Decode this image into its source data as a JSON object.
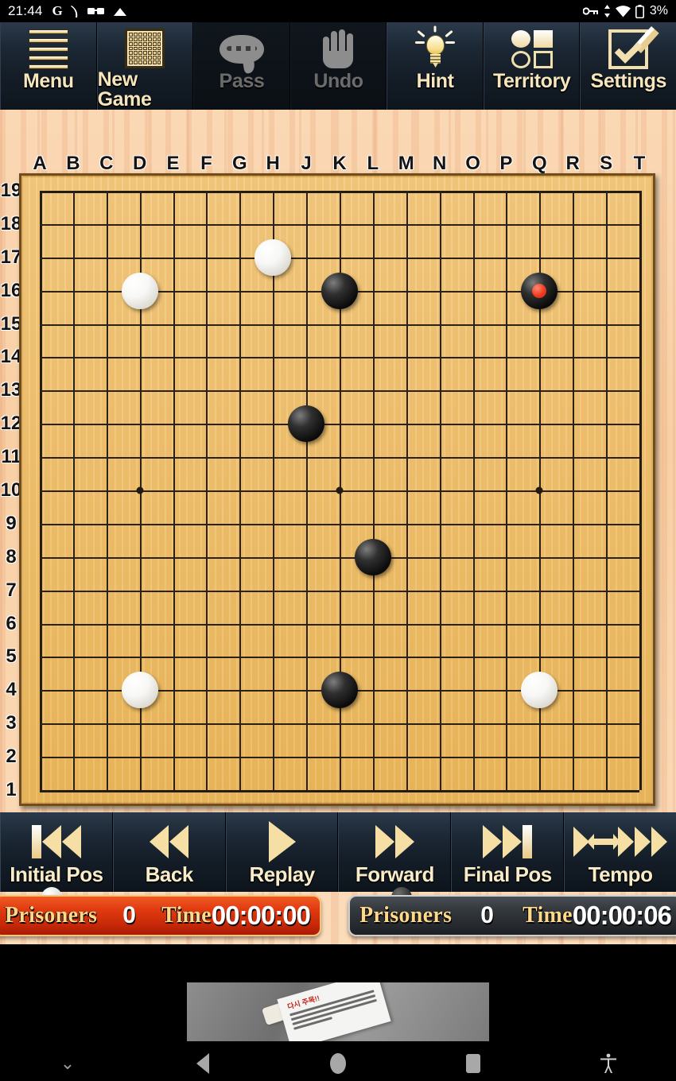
{
  "status_bar": {
    "clock": "21:44",
    "left_icons": [
      "google-g-icon",
      "signal-icon",
      "glasses-icon",
      "cloud-icon"
    ],
    "right_icons": [
      "vpn-key-icon",
      "data-transfer-icon",
      "wifi-icon",
      "battery-icon"
    ],
    "battery_percent": "3%"
  },
  "toolbar": {
    "buttons": [
      {
        "label": "Menu",
        "icon": "hamburger-menu-icon",
        "enabled": true
      },
      {
        "label": "New Game",
        "icon": "go-board-grid-icon",
        "enabled": true
      },
      {
        "label": "Pass",
        "icon": "speech-bubble-icon",
        "enabled": false
      },
      {
        "label": "Undo",
        "icon": "hand-stop-icon",
        "enabled": false
      },
      {
        "label": "Hint",
        "icon": "lightbulb-icon",
        "enabled": true
      },
      {
        "label": "Territory",
        "icon": "territory-shapes-icon",
        "enabled": true
      },
      {
        "label": "Settings",
        "icon": "checkbox-pencil-icon",
        "enabled": true
      }
    ]
  },
  "board": {
    "size": 19,
    "column_labels": [
      "A",
      "B",
      "C",
      "D",
      "E",
      "F",
      "G",
      "H",
      "J",
      "K",
      "L",
      "M",
      "N",
      "O",
      "P",
      "Q",
      "R",
      "S",
      "T"
    ],
    "row_labels": [
      "19",
      "18",
      "17",
      "16",
      "15",
      "14",
      "13",
      "12",
      "11",
      "10",
      "9",
      "8",
      "7",
      "6",
      "5",
      "4",
      "3",
      "2",
      "1"
    ],
    "star_points": [
      {
        "col": "D",
        "row": 16
      },
      {
        "col": "K",
        "row": 16
      },
      {
        "col": "Q",
        "row": 16
      },
      {
        "col": "D",
        "row": 10
      },
      {
        "col": "K",
        "row": 10
      },
      {
        "col": "Q",
        "row": 10
      },
      {
        "col": "D",
        "row": 4
      },
      {
        "col": "K",
        "row": 4
      },
      {
        "col": "Q",
        "row": 4
      }
    ],
    "stones": [
      {
        "col": "D",
        "row": 16,
        "color": "white",
        "last": false
      },
      {
        "col": "H",
        "row": 17,
        "color": "white",
        "last": false
      },
      {
        "col": "K",
        "row": 16,
        "color": "black",
        "last": false
      },
      {
        "col": "Q",
        "row": 16,
        "color": "black",
        "last": true
      },
      {
        "col": "J",
        "row": 12,
        "color": "black",
        "last": false
      },
      {
        "col": "L",
        "row": 8,
        "color": "black",
        "last": false
      },
      {
        "col": "D",
        "row": 4,
        "color": "white",
        "last": false
      },
      {
        "col": "K",
        "row": 4,
        "color": "black",
        "last": false
      },
      {
        "col": "Q",
        "row": 4,
        "color": "white",
        "last": false
      }
    ]
  },
  "nav_controls": {
    "buttons": [
      {
        "label": "Initial Pos",
        "icon": "skip-to-start-icon"
      },
      {
        "label": "Back",
        "icon": "rewind-icon"
      },
      {
        "label": "Replay",
        "icon": "play-icon"
      },
      {
        "label": "Forward",
        "icon": "fast-forward-icon"
      },
      {
        "label": "Final Pos",
        "icon": "skip-to-end-icon"
      },
      {
        "label": "Tempo",
        "icon": "tempo-speed-icon"
      }
    ]
  },
  "players": {
    "left": {
      "stone": "white",
      "prisoners_label": "Prisoners",
      "prisoners_value": "0",
      "time_label": "Time",
      "time_value": "00:00:00",
      "active": true,
      "accent_color": "#e03a10"
    },
    "right": {
      "stone": "black",
      "prisoners_label": "Prisoners",
      "prisoners_value": "0",
      "time_label": "Time",
      "time_value": "00:00:06",
      "active": false,
      "accent_color": "#2a2e33"
    }
  },
  "ad": {
    "headline": "다시 주목!!",
    "line_count": 4
  },
  "android_nav": {
    "items": [
      "hide-keyboard-icon",
      "back-icon",
      "home-icon",
      "recents-icon",
      "accessibility-icon"
    ]
  }
}
